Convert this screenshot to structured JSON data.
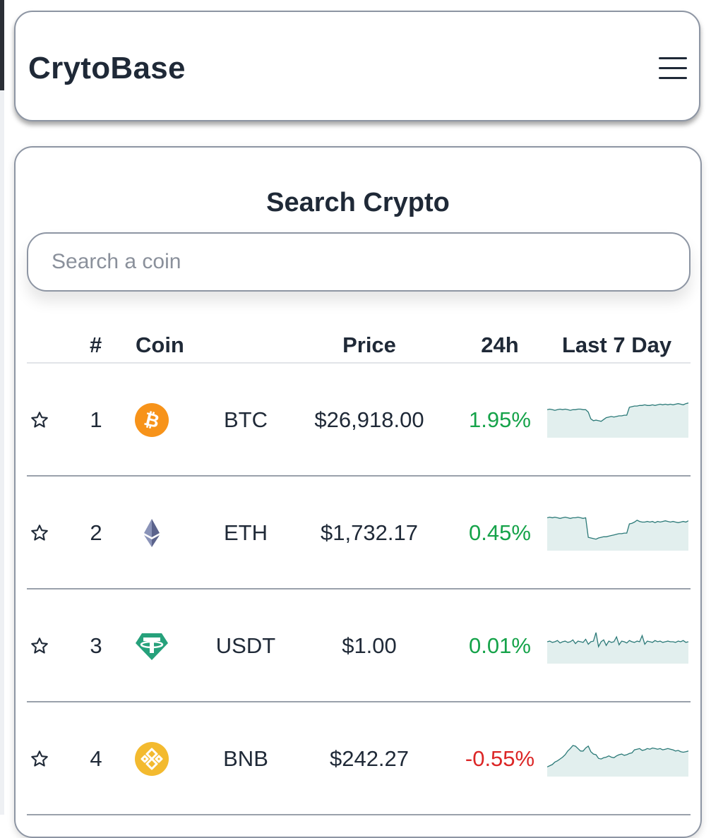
{
  "navbar": {
    "brand": "CrytoBase",
    "menu_icon": "hamburger-menu-icon"
  },
  "search_panel": {
    "title": "Search Crypto",
    "search_placeholder": "Search a coin",
    "search_value": ""
  },
  "table": {
    "headers": {
      "rank": "#",
      "coin": "Coin",
      "price": "Price",
      "change": "24h",
      "chart": "Last 7 Day"
    },
    "rows": [
      {
        "rank": "1",
        "symbol": "BTC",
        "price": "$26,918.00",
        "change": "1.95%",
        "trend": "up",
        "logo_icon": "bitcoin-logo-icon",
        "logo_color": "#f7931a",
        "spark": [
          40,
          41,
          40,
          39,
          40,
          41,
          40,
          41,
          40,
          39,
          40,
          40,
          41,
          41,
          40,
          40,
          36,
          25,
          22,
          23,
          22,
          21,
          24,
          27,
          28,
          29,
          28,
          29,
          30,
          30,
          31,
          31,
          44,
          45,
          46,
          46,
          47,
          47,
          48,
          47,
          47,
          48,
          47,
          48,
          49,
          48,
          49,
          48,
          49,
          48,
          49,
          50,
          49,
          48,
          50,
          51
        ]
      },
      {
        "rank": "2",
        "symbol": "ETH",
        "price": "$1,732.17",
        "change": "0.45%",
        "trend": "up",
        "logo_icon": "ethereum-logo-icon",
        "logo_color": "#627eea",
        "spark": [
          48,
          49,
          48,
          49,
          48,
          47,
          48,
          49,
          48,
          47,
          48,
          48,
          49,
          48,
          47,
          48,
          16,
          15,
          14,
          13,
          15,
          16,
          17,
          17,
          18,
          19,
          20,
          21,
          22,
          22,
          23,
          23,
          38,
          39,
          41,
          44,
          42,
          41,
          41,
          42,
          41,
          42,
          40,
          42,
          41,
          42,
          43,
          42,
          41,
          42,
          41,
          40,
          41,
          42,
          41,
          43
        ]
      },
      {
        "rank": "3",
        "symbol": "USDT",
        "price": "$1.00",
        "change": "0.01%",
        "trend": "up",
        "logo_icon": "tether-logo-icon",
        "logo_color": "#26a17b",
        "spark": [
          30,
          31,
          29,
          30,
          32,
          28,
          30,
          31,
          29,
          30,
          33,
          27,
          31,
          30,
          29,
          34,
          26,
          30,
          31,
          45,
          22,
          30,
          33,
          24,
          31,
          29,
          30,
          38,
          25,
          31,
          30,
          28,
          32,
          30,
          29,
          31,
          30,
          40,
          26,
          31,
          30,
          29,
          32,
          30,
          31,
          29,
          30,
          31,
          30,
          30,
          29,
          31,
          30,
          32,
          29,
          30
        ]
      },
      {
        "rank": "4",
        "symbol": "BNB",
        "price": "$242.27",
        "change": "-0.55%",
        "trend": "down",
        "logo_icon": "bnb-logo-icon",
        "logo_color": "#f3ba2f",
        "spark": [
          10,
          12,
          14,
          18,
          20,
          23,
          26,
          30,
          36,
          40,
          45,
          44,
          40,
          36,
          36,
          41,
          44,
          35,
          31,
          30,
          24,
          23,
          25,
          26,
          28,
          26,
          25,
          28,
          30,
          31,
          29,
          30,
          32,
          33,
          38,
          39,
          40,
          37,
          38,
          40,
          39,
          41,
          40,
          39,
          40,
          38,
          39,
          40,
          39,
          38,
          36,
          37,
          35,
          34,
          35,
          36
        ]
      }
    ]
  },
  "colors": {
    "text": "#1f2937",
    "positive": "#16a34a",
    "negative": "#dc2626",
    "sparkline_stroke": "#2c7a78",
    "sparkline_fill": "#e2efee",
    "border": "#8d95a3"
  }
}
